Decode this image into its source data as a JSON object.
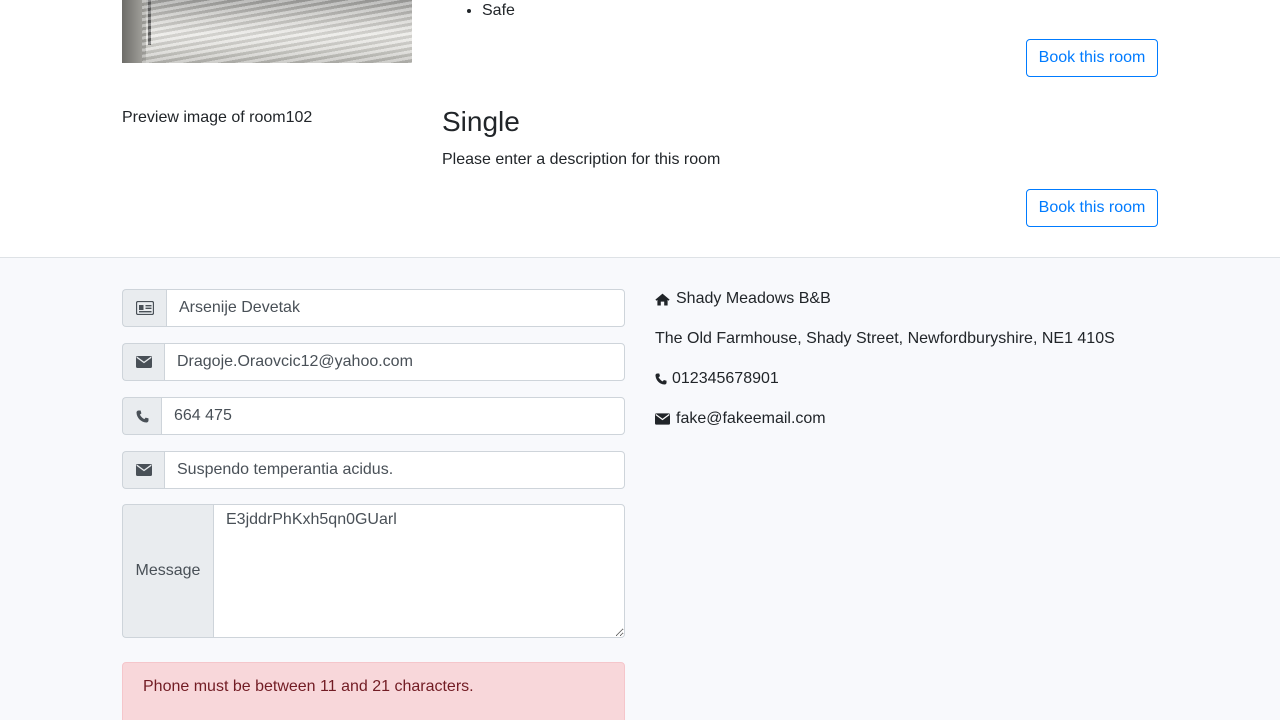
{
  "rooms": [
    {
      "features": [
        "Safe"
      ],
      "book_label": "Book this room"
    },
    {
      "image_alt": "Preview image of room102",
      "title": "Single",
      "description": "Please enter a description for this room",
      "book_label": "Book this room"
    }
  ],
  "contact_form": {
    "name_value": "Arsenije Devetak",
    "email_value": "Dragoje.Oraovcic12@yahoo.com",
    "phone_value": "664 475",
    "subject_value": "Suspendo temperantia acidus.",
    "message_label": "Message",
    "message_value": "E3jddrPhKxh5qn0GUarl",
    "error": "Phone must be between 11 and 21 characters."
  },
  "business": {
    "name": "Shady Meadows B&B",
    "address": "The Old Farmhouse, Shady Street, Newfordburyshire, NE1 410S",
    "phone": "012345678901",
    "email": "fake@fakeemail.com"
  },
  "icons": {
    "name": "id-card-icon",
    "email": "envelope-icon",
    "phone": "phone-icon",
    "subject": "envelope-icon",
    "home": "home-icon"
  },
  "colors": {
    "primary": "#007bff",
    "alert_bg": "#f8d7da",
    "alert_text": "#721c24",
    "section_bg": "#f8f9fc"
  }
}
